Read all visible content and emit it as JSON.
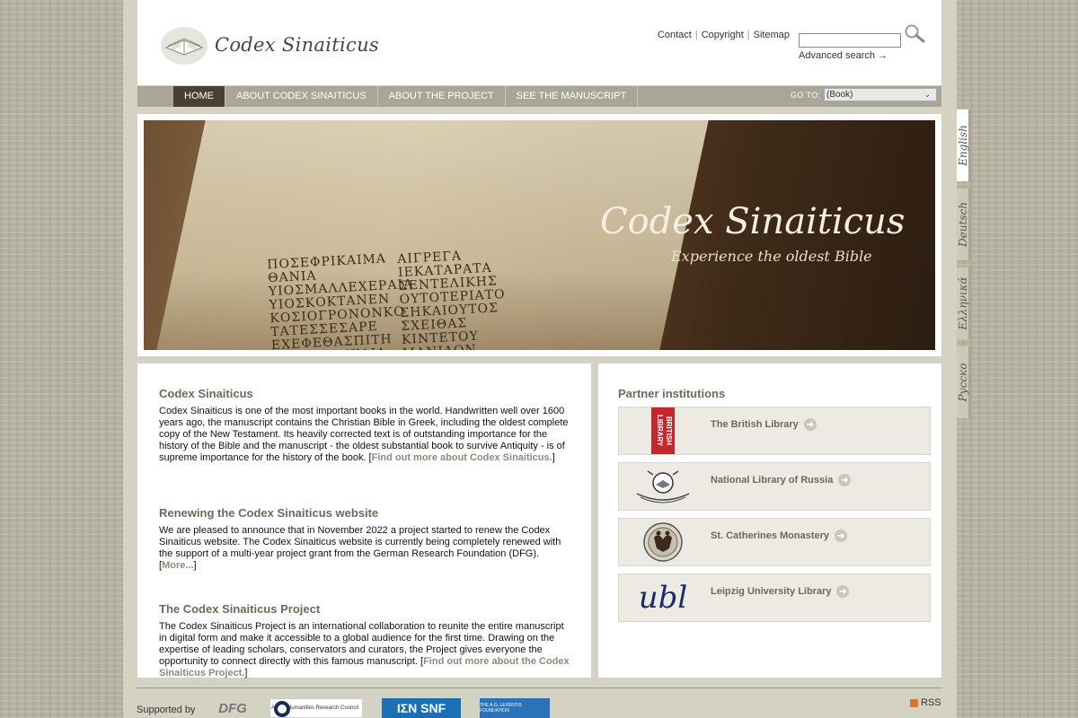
{
  "site": {
    "logo_text": "Codex Sinaiticus"
  },
  "toplinks": {
    "contact": "Contact",
    "copyright": "Copyright",
    "sitemap": "Sitemap",
    "separator": "|"
  },
  "search": {
    "value": "",
    "advanced_label": "Advanced search"
  },
  "nav": {
    "items": [
      {
        "label": "HOME",
        "active": true
      },
      {
        "label": "ABOUT CODEX SINAITICUS",
        "active": false
      },
      {
        "label": "ABOUT THE PROJECT",
        "active": false
      },
      {
        "label": "SEE THE MANUSCRIPT",
        "active": false
      }
    ],
    "goto_label": "GO TO:",
    "goto_selected": "(Book)"
  },
  "languages": [
    "English",
    "Deutsch",
    "Ελληνικά",
    "Русско"
  ],
  "banner": {
    "title": "Codex Sinaiticus",
    "subtitle": "Experience the oldest Bible",
    "greek_col1": [
      "ΠΟΣΕΦΡΙΚΑΙΜΑ",
      "ΘΑΝΙΑ",
      "ΥΙΟΣΜΑΛΛΕΧΕΡΑΙΑ",
      "ΥΙΟΣΚΟΚΤΑΝΕΝ",
      "ΚΟΣΙΟΓΡΟΝΟΝΚΟ",
      "ΤΑΤΕΣΣΕΣΑΡΕ",
      "ΕΧΕΦΕΘΑΣΠΙΤΗ",
      "ΛΙΕΚΑΤΟΝΚΑΙΑ"
    ],
    "greek_col2": [
      "ΑΙΓΡΕΓΑ",
      "ΙΕΚΑΤΑΡΑΤΑ",
      "ΣΕΝΤΕΛΙΚΗΣ",
      "ΟΥΤΟΤΕΡΙΑΤΟ",
      "ΣΗΚΑΙΟΥΤΟΣ",
      "ΣΧΕΙΘΑΣ",
      "ΚΙΝΤΕΤΟΥ",
      "ΜΑΝΙΑΟΝ"
    ]
  },
  "sections": [
    {
      "title": "Codex Sinaiticus",
      "body": "Codex Sinaiticus is one of the most important books in the world. Handwritten well over 1600 years ago, the manuscript contains the Christian Bible in Greek, including the oldest complete copy of the New Testament. Its heavily corrected text is of outstanding importance for the history of the Bible and the manuscript - the oldest substantial book to survive Antiquity - is of supreme importance for the history of the book. [",
      "link": "Find out more about Codex Sinaiticus.",
      "tail": "]"
    },
    {
      "title": "Renewing the Codex Sinaiticus website",
      "body": "We are pleased to announce that in November 2022 a project started to renew the Codex Sinaiticus website. The Codex Sinaiticus website is currently being completely renewed with the support of a multi-year project grant from the German Research Foundation (DFG). [",
      "link": "More...",
      "tail": "]"
    },
    {
      "title": "The Codex Sinaiticus Project",
      "body": "The Codex Sinaiticus Project is an international collaboration to reunite the entire manuscript in digital form and make it accessible to a global audience for the first time. Drawing on the expertise of leading scholars, conservators and curators, the Project gives everyone the opportunity to connect directly with this famous manuscript. [",
      "link": "Find out more about the Codex Sinaiticus Project.",
      "tail": "]"
    }
  ],
  "partners": {
    "title": "Partner institutions",
    "items": [
      {
        "name": "The British Library",
        "logo_text": "BRITISH LIBRARY"
      },
      {
        "name": "National Library of Russia",
        "logo_text": ""
      },
      {
        "name": "St. Catherines Monastery",
        "logo_text": ""
      },
      {
        "name": "Leipzig University Library",
        "logo_text": "ubl"
      }
    ]
  },
  "footer": {
    "supported_by": "Supported by",
    "sponsors": [
      "DFG",
      "Arts & Humanities Research Council",
      "ΙΣΝ SNF",
      "THE A.G. LEVENTIS FOUNDATION"
    ],
    "rss": "RSS"
  },
  "colors": {
    "nav_bg": "#a9a697",
    "nav_active": "#4a3f34",
    "heading": "#6b6a5c",
    "bl_red": "#c0282d"
  }
}
